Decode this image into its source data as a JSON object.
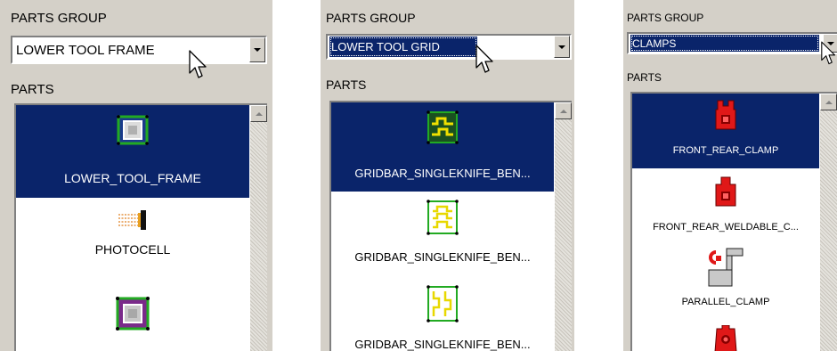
{
  "panels": [
    {
      "parts_group_label": "PARTS GROUP",
      "selected_group": "LOWER TOOL FRAME",
      "parts_label": "PARTS",
      "items": [
        {
          "label": "LOWER_TOOL_FRAME",
          "icon": "lower-tool-frame-icon",
          "selected": true
        },
        {
          "label": "PHOTOCELL",
          "icon": "photocell-icon",
          "selected": false
        },
        {
          "label": "",
          "icon": "tool-frame-icon",
          "selected": false
        }
      ]
    },
    {
      "parts_group_label": "PARTS GROUP",
      "selected_group": "LOWER TOOL GRID",
      "parts_label": "PARTS",
      "items": [
        {
          "label": "GRIDBAR_SINGLEKNIFE_BEN...",
          "icon": "gridbar-icon",
          "selected": true
        },
        {
          "label": "GRIDBAR_SINGLEKNIFE_BEN...",
          "icon": "gridbar-icon",
          "selected": false
        },
        {
          "label": "GRIDBAR_SINGLEKNIFE_BEN...",
          "icon": "gridbar-icon",
          "selected": false
        }
      ]
    },
    {
      "parts_group_label": "PARTS GROUP",
      "selected_group": "CLAMPS",
      "parts_label": "PARTS",
      "items": [
        {
          "label": "FRONT_REAR_CLAMP",
          "icon": "front-rear-clamp-icon",
          "selected": true
        },
        {
          "label": "FRONT_REAR_WELDABLE_C...",
          "icon": "weldable-clamp-icon",
          "selected": false
        },
        {
          "label": "PARALLEL_CLAMP",
          "icon": "parallel-clamp-icon",
          "selected": false
        },
        {
          "label": "",
          "icon": "clamp-icon",
          "selected": false
        }
      ]
    }
  ]
}
